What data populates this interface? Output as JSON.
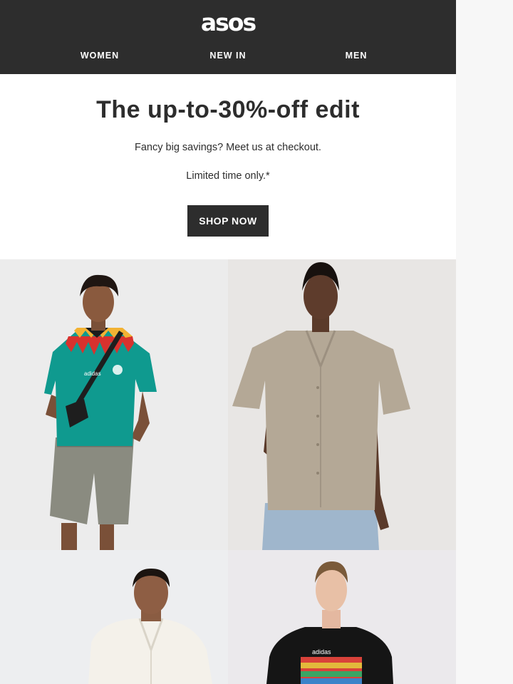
{
  "brand": {
    "logo_text": "asos"
  },
  "nav": {
    "items": [
      {
        "label": "WOMEN"
      },
      {
        "label": "NEW IN"
      },
      {
        "label": "MEN"
      }
    ]
  },
  "hero": {
    "title": "The up-to-30%-off edit",
    "subtitle": "Fancy big savings? Meet us at checkout.",
    "note": "Limited time only.*",
    "cta_label": "SHOP NOW"
  },
  "products": [
    {
      "image": "man-in-teal-adidas-football-shirt-and-denim-shorts",
      "jersey_logo": "adidas"
    },
    {
      "image": "man-in-beige-short-sleeve-shirt"
    },
    {
      "image": "man-in-white-knit-polo"
    },
    {
      "image": "man-in-black-adidas-graphic-tee",
      "tee_logo": "adidas"
    }
  ],
  "colors": {
    "header_bg": "#2d2d2d",
    "text": "#2d2d2d",
    "cta_bg": "#2d2d2d",
    "page_bg": "#f7f7f7"
  }
}
